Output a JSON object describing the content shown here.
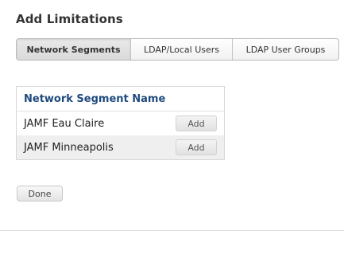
{
  "panel": {
    "title": "Add Limitations"
  },
  "tabs": [
    {
      "label": "Network Segments",
      "active": true
    },
    {
      "label": "LDAP/Local Users",
      "active": false
    },
    {
      "label": "LDAP User Groups",
      "active": false
    }
  ],
  "table": {
    "header": "Network Segment Name",
    "rows": [
      {
        "name": "JAMF Eau Claire",
        "action": "Add"
      },
      {
        "name": "JAMF Minneapolis",
        "action": "Add"
      }
    ]
  },
  "footer": {
    "done_label": "Done"
  }
}
